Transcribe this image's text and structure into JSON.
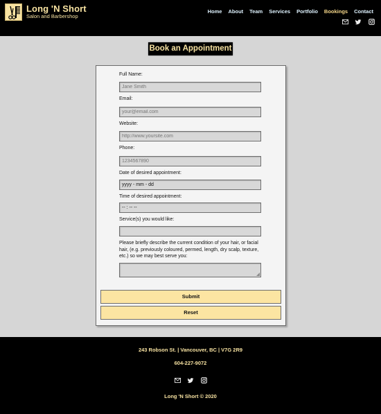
{
  "header": {
    "brand_name": "Long 'N Short",
    "brand_tagline": "Salon and Barbershop",
    "nav": [
      {
        "label": "Home",
        "active": false
      },
      {
        "label": "About",
        "active": false
      },
      {
        "label": "Team",
        "active": false
      },
      {
        "label": "Services",
        "active": false
      },
      {
        "label": "Portfolio",
        "active": false
      },
      {
        "label": "Bookings",
        "active": true
      },
      {
        "label": "Contact",
        "active": false
      }
    ],
    "social_icons": [
      "email-icon",
      "twitter-icon",
      "instagram-icon"
    ]
  },
  "page": {
    "title": "Book an Appointment"
  },
  "form": {
    "fields": [
      {
        "label": "Full Name:",
        "placeholder": "Jane Smith",
        "value": ""
      },
      {
        "label": "Email:",
        "placeholder": "your@email.com",
        "value": ""
      },
      {
        "label": "Website:",
        "placeholder": "http://www.yoursite.com",
        "value": ""
      },
      {
        "label": "Phone:",
        "placeholder": "1234567890",
        "value": ""
      },
      {
        "label": "Date of desired appointment:",
        "placeholder": "",
        "value": "yyyy - mm - dd"
      },
      {
        "label": "Time of desired appointment:",
        "placeholder": "",
        "value": "-- : -- --"
      },
      {
        "label": "Service(s) you would like:",
        "placeholder": "",
        "value": ""
      }
    ],
    "description_label": "Please briefly describe the current condition of your hair, or facial hair, (e.g. previously coloured, permed, length, dry scalp, texture, etc.) so we may best serve you:",
    "description_value": "",
    "submit_label": "Submit",
    "reset_label": "Reset"
  },
  "footer": {
    "address": "243 Robson St.  |  Vancouver, BC  |  V7G 2R9",
    "phone": "604-227-9072",
    "copyright": "Long 'N Short © 2020",
    "social_icons": [
      "email-icon",
      "twitter-icon",
      "instagram-icon"
    ]
  },
  "colors": {
    "accent": "#f7e2a1",
    "button": "#fce5a2",
    "nav_text": "#dff3ff",
    "nav_active": "#f7d88a",
    "header_bg": "#000000",
    "page_bg": "#d6d6d6"
  }
}
